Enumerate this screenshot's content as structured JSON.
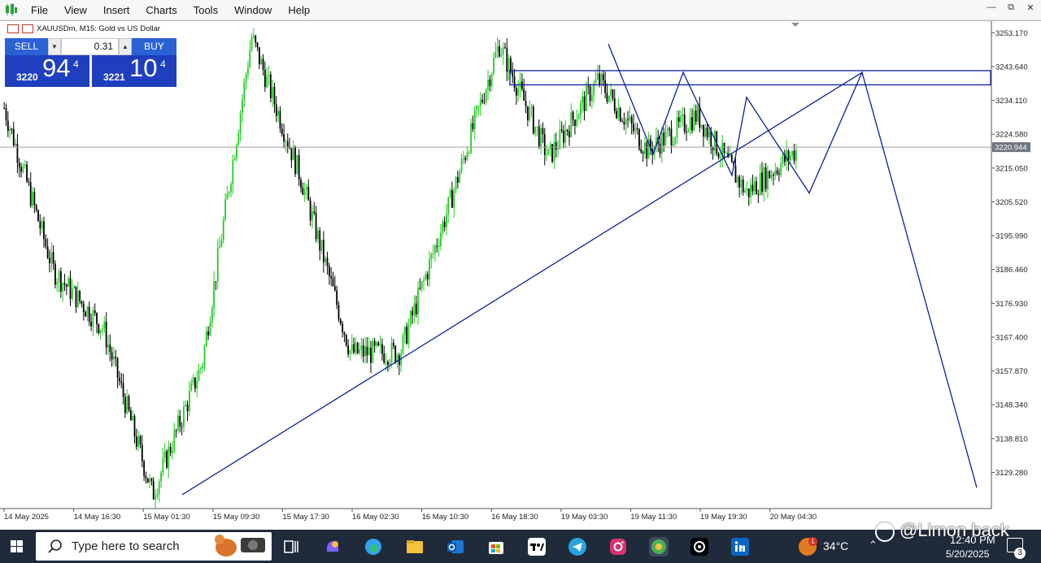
{
  "menu": {
    "items": [
      "File",
      "View",
      "Insert",
      "Charts",
      "Tools",
      "Window",
      "Help"
    ]
  },
  "chart": {
    "caption": "XAUUSDm, M15:  Gold vs US Dollar",
    "current_price_label": "3220.944",
    "y_ticks": [
      "3253.170",
      "3243.640",
      "3234.110",
      "3224.580",
      "3215.050",
      "3205.520",
      "3195.990",
      "3186.460",
      "3176.930",
      "3167.400",
      "3157.870",
      "3148.340",
      "3138.810",
      "3129.280"
    ],
    "x_ticks": [
      "14 May 2025",
      "14 May 16:30",
      "15 May 01:30",
      "15 May 09:30",
      "15 May 17:30",
      "16 May 02:30",
      "16 May 10:30",
      "16 May 18:30",
      "19 May 03:30",
      "19 May 11:30",
      "19 May 19:30",
      "20 May 04:30"
    ],
    "colors": {
      "bull": "#22cc22",
      "bear": "#000000",
      "drawing": "#0a1f9e",
      "axis": "#555555"
    }
  },
  "chart_data": {
    "type": "candlestick",
    "title": "XAUUSDm, M15:  Gold vs US Dollar",
    "xlabel": "",
    "ylabel": "",
    "ylim": [
      3120,
      3256
    ],
    "x": [
      "14 May 2025",
      "14 May 16:30",
      "15 May 01:30",
      "15 May 09:30",
      "15 May 17:30",
      "16 May 02:30",
      "16 May 10:30",
      "16 May 18:30",
      "19 May 03:30",
      "19 May 11:30",
      "19 May 19:30",
      "20 May 04:30"
    ],
    "series": [
      {
        "values": [
          3232,
          3186,
          3170,
          3123,
          3160,
          3252,
          3212,
          3163,
          3163,
          3205,
          3250,
          3218,
          3240,
          3220,
          3230,
          3208,
          3220
        ]
      }
    ],
    "current_price": 3220.944,
    "drawings": {
      "trendline_low": 3123,
      "trendline_high": 3242,
      "resistance_zone": [
        3238.5,
        3242.5
      ],
      "projection_target": 3125
    }
  },
  "trade_panel": {
    "sell_label": "SELL",
    "buy_label": "BUY",
    "lot": "0.31",
    "sell_small": "3220",
    "sell_big": "94",
    "sell_sup": "4",
    "buy_small": "3221",
    "buy_big": "10",
    "buy_sup": "4"
  },
  "taskbar": {
    "search_placeholder": "Type here to search",
    "temperature": "34°C",
    "weather_badge": "1",
    "time": "12:40 PM",
    "date": "5/20/2025",
    "notifications": "3",
    "watermark": "@Limon back"
  }
}
